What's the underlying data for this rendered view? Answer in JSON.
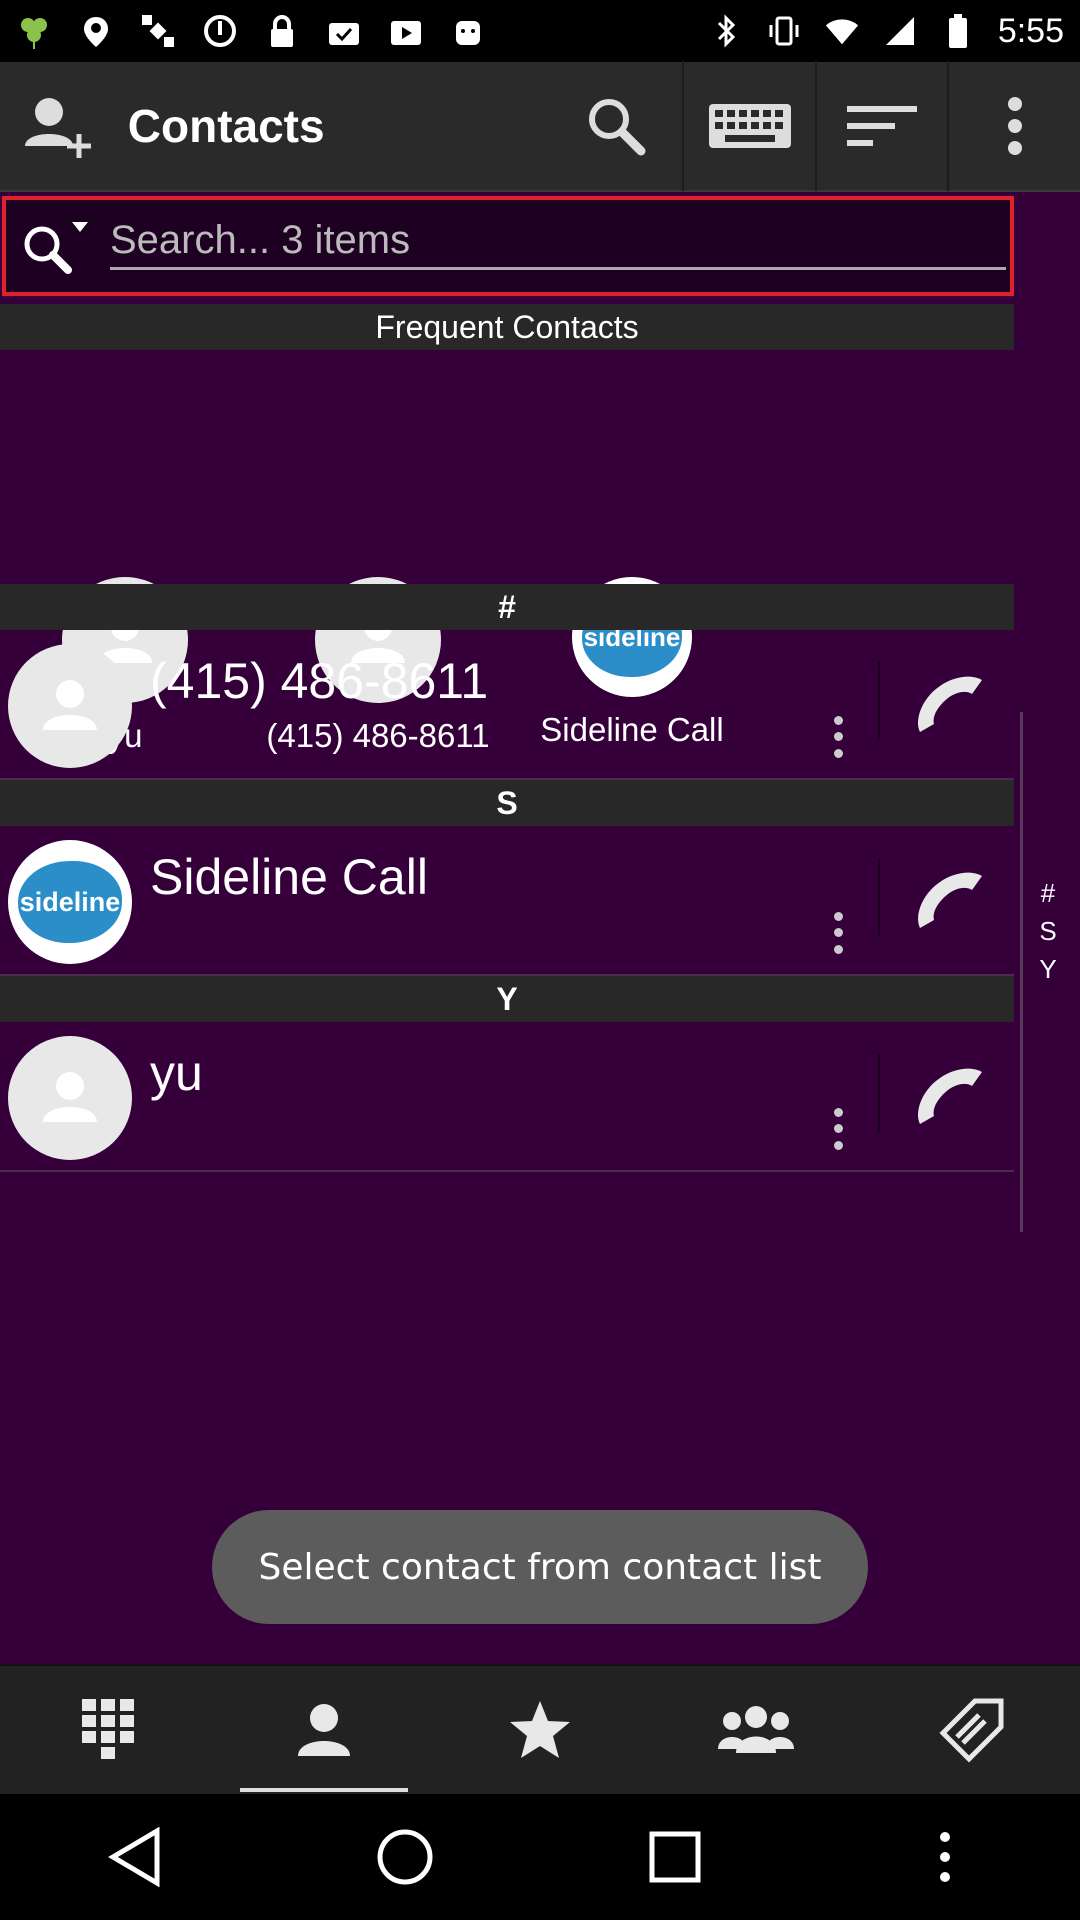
{
  "status_bar": {
    "time": "5:55",
    "left_icons": [
      "clover-icon",
      "fake-gps-icon",
      "satellite-icon",
      "sync-icon",
      "lock-icon",
      "briefcase-check-icon",
      "play-store-icon",
      "android-icon"
    ],
    "right_icons": [
      "bluetooth-icon",
      "vibrate-icon",
      "wifi-icon",
      "signal-icon",
      "battery-icon"
    ]
  },
  "action_bar": {
    "title": "Contacts",
    "buttons": [
      "search-icon",
      "keyboard-icon",
      "sort-icon",
      "overflow-menu-icon"
    ]
  },
  "search": {
    "placeholder": "Search... 3 items",
    "value": ""
  },
  "frequent": {
    "header": "Frequent Contacts",
    "items": [
      {
        "label": "yu",
        "avatar": "person"
      },
      {
        "label": "(415) 486-8611",
        "avatar": "person"
      },
      {
        "label": "Sideline Call",
        "avatar": "sideline"
      }
    ]
  },
  "sections": [
    {
      "header": "#",
      "contact": {
        "name": "(415) 486-8611",
        "avatar": "person"
      }
    },
    {
      "header": "S",
      "contact": {
        "name": "Sideline Call",
        "avatar": "sideline"
      }
    },
    {
      "header": "Y",
      "contact": {
        "name": "yu",
        "avatar": "person"
      }
    }
  ],
  "sideline_logo_text": "sideline",
  "index_letters": [
    "#",
    "S",
    "Y"
  ],
  "toast": "Select contact from contact list",
  "tabs": [
    {
      "name": "dialpad",
      "active": false
    },
    {
      "name": "contacts",
      "active": true
    },
    {
      "name": "favorites",
      "active": false
    },
    {
      "name": "groups",
      "active": false
    },
    {
      "name": "notes",
      "active": false
    }
  ],
  "colors": {
    "background": "#35003a",
    "action_bar": "#2a2a2a",
    "search_border": "#e0202a",
    "call_icon": "#e8e8e8"
  }
}
